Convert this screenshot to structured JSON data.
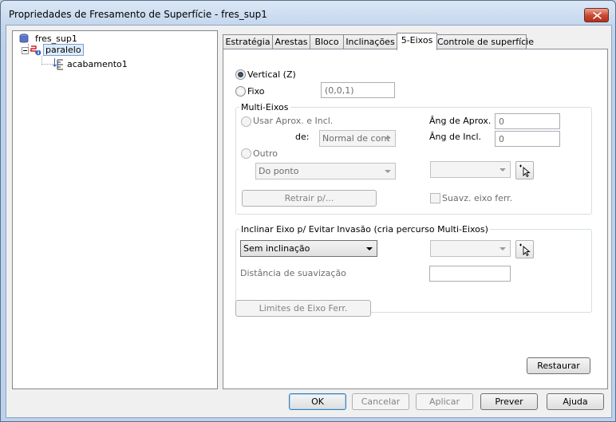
{
  "window": {
    "title": "Propriedades de Fresamento de Superfície - fres_sup1"
  },
  "tree": {
    "root": {
      "label": "fres_sup1"
    },
    "child": {
      "label": "paralelo"
    },
    "grandchild": {
      "label": "acabamento1"
    }
  },
  "tabs": [
    {
      "label": "Estratégia"
    },
    {
      "label": "Arestas"
    },
    {
      "label": "Bloco"
    },
    {
      "label": "Inclinações"
    },
    {
      "label": "5-Eixos"
    },
    {
      "label": "Controle de superfície"
    }
  ],
  "axis": {
    "vertical_label": "Vertical (Z)",
    "fixed_label": "Fixo",
    "fixed_value": "(0,0,1)"
  },
  "multi_axis": {
    "title": "Multi-Eixos",
    "use_lead_tilt_label": "Usar Aprox. e Incl.",
    "from_label": "de:",
    "from_value": "Normal de cont",
    "lead_angle_label": "Âng de Aprox.",
    "lead_angle_value": "0",
    "tilt_angle_label": "Âng de Incl.",
    "tilt_angle_value": "0",
    "other_label": "Outro",
    "other_value": "Do ponto",
    "retract_label": "Retrair p/...",
    "smooth_axis_label": "Suavz. eixo ferr."
  },
  "tilt": {
    "title": "Inclinar Eixo p/ Evitar Invasão (cria percurso Multi-Eixos)",
    "mode_value": "Sem inclinação",
    "smoothing_label": "Distância de suavização",
    "smoothing_value": ""
  },
  "tool_axis_limits_label": "Limites de Eixo Ferr.",
  "restore_label": "Restaurar",
  "footer": {
    "ok": "OK",
    "cancel": "Cancelar",
    "apply": "Aplicar",
    "preview": "Prever",
    "help": "Ajuda"
  }
}
